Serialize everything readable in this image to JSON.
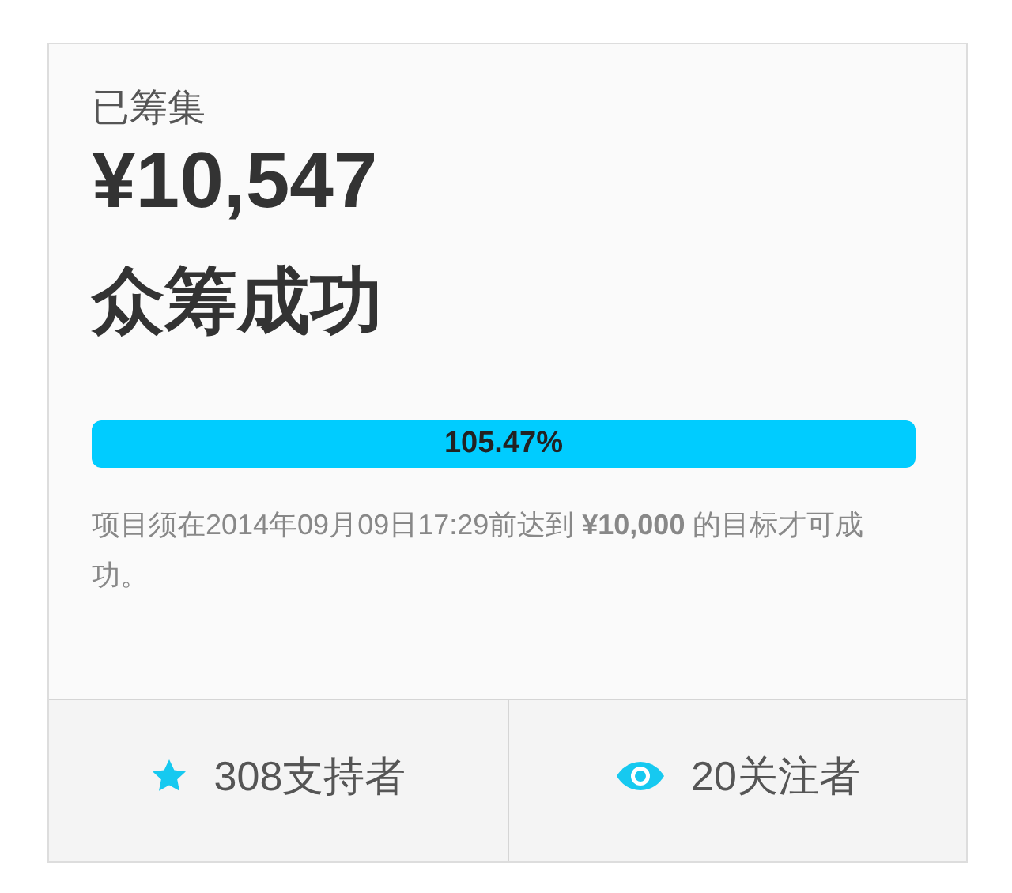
{
  "raised_label": "已筹集",
  "amount": "¥10,547",
  "status": "众筹成功",
  "progress": {
    "level": 1,
    "label": "105.47%"
  },
  "note": "项目须在2014年09月09日17:29前达到 **¥10,000** 的目标才可成功。",
  "stats": [
    {
      "kind": "backers",
      "text": "308支持者"
    },
    {
      "kind": "followers",
      "text": "20关注者"
    }
  ]
}
